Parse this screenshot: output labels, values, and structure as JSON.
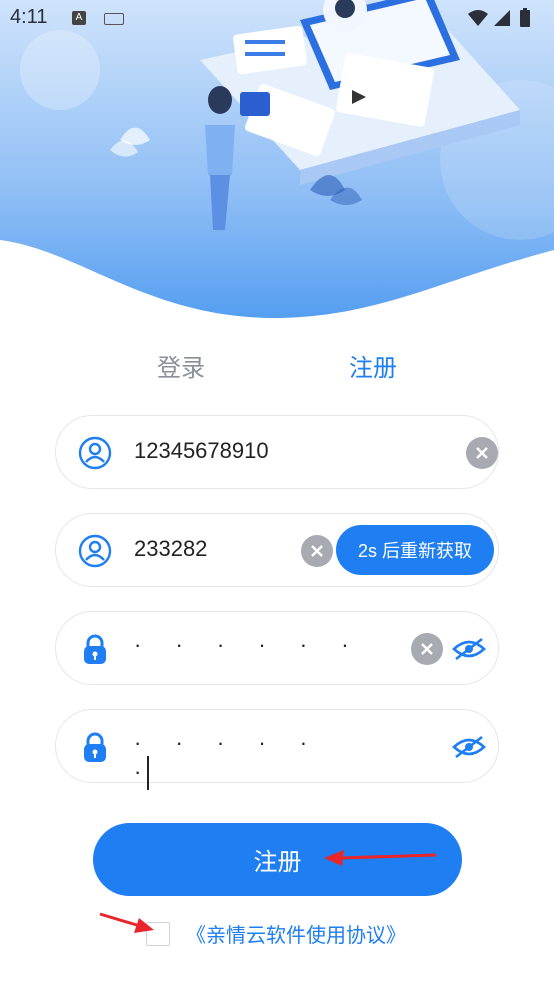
{
  "status_bar": {
    "time": "4:11",
    "a_badge": "A"
  },
  "tabs": {
    "login": "登录",
    "register": "注册"
  },
  "fields": {
    "phone": {
      "value": "12345678910"
    },
    "code": {
      "value": "233282",
      "resend_label": "2s 后重新获取"
    },
    "password": {
      "value": "· · · · · ·"
    },
    "confirm_password": {
      "value": "· · · · · ·"
    }
  },
  "submit_label": "注册",
  "agreement": {
    "link": "《亲情云软件使用协议》"
  },
  "colors": {
    "accent": "#1e7ef2",
    "border": "#e3e6eb",
    "clear": "#a7aab0",
    "tab_inactive": "#8a8f99"
  },
  "icons": [
    "user-icon",
    "lock-icon",
    "clear-icon",
    "eye-off-icon",
    "wifi-icon",
    "signal-icon",
    "battery-icon",
    "keyboard-icon"
  ]
}
